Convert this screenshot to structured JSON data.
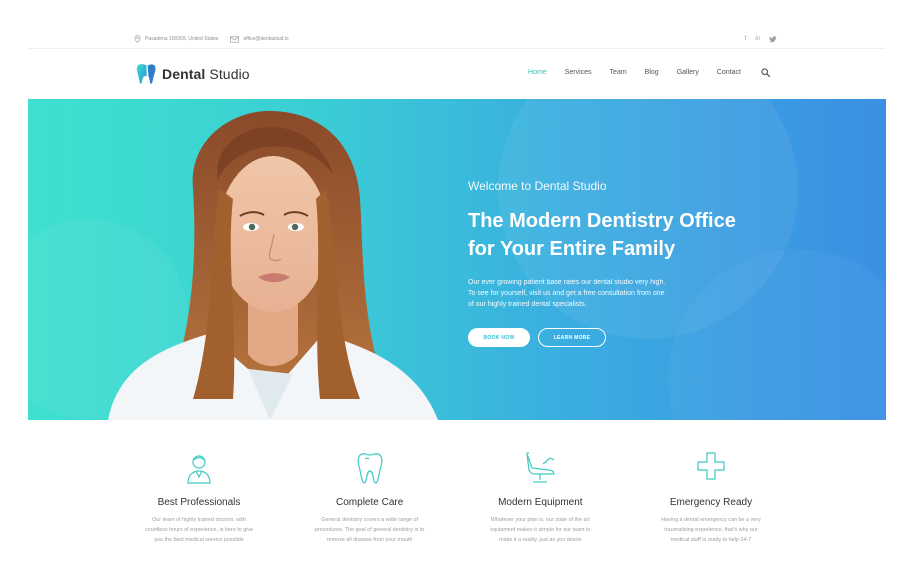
{
  "topbar": {
    "address": "Pasadena 100269, United States",
    "email": "office@dentalstud.io",
    "social": {
      "facebook": "f",
      "linkedin": "in",
      "twitter": "t"
    }
  },
  "logo": {
    "bold": "Dental",
    "light": " Studio"
  },
  "nav": {
    "items": [
      {
        "label": "Home",
        "active": true
      },
      {
        "label": "Services",
        "active": false
      },
      {
        "label": "Team",
        "active": false
      },
      {
        "label": "Blog",
        "active": false
      },
      {
        "label": "Gallery",
        "active": false
      },
      {
        "label": "Contact",
        "active": false
      }
    ],
    "search_icon": "search-icon"
  },
  "hero": {
    "kicker": "Welcome to Dental Studio",
    "title_line1": "The Modern Dentistry Office",
    "title_line2": "for Your Entire Family",
    "desc_line1": "Our ever growing patient base rates our dental studio very high.",
    "desc_line2": "To see for yourself, visit us and get a free consultation from one",
    "desc_line3": "of our highly trained dental specialists.",
    "book_button": "Book Now",
    "learn_button": "Learn More"
  },
  "features": [
    {
      "icon": "doctor-icon",
      "title": "Best Professionals",
      "desc_line1": "Our team of highly trained doctors, with",
      "desc_line2": "countless hours of experience, is here to give",
      "desc_line3": "you the best medical service possible"
    },
    {
      "icon": "tooth-icon",
      "title": "Complete Care",
      "desc_line1": "General dentistry covers a wide range of",
      "desc_line2": "procedures. The goal of general dentistry is to",
      "desc_line3": "remove all disease from your mouth"
    },
    {
      "icon": "dental-chair-icon",
      "title": "Modern Equipment",
      "desc_line1": "Whatever your plan is, our state of the art",
      "desc_line2": "equipment makes it simple for our team to",
      "desc_line3": "make it a reality, just as you desire"
    },
    {
      "icon": "medical-cross-icon",
      "title": "Emergency Ready",
      "desc_line1": "Having a dental emergency can be a very",
      "desc_line2": "traumatizing experience, that's why our",
      "desc_line3": "medical staff is ready to help 24-7"
    }
  ],
  "colors": {
    "accent": "#2fc8b8",
    "hero_start": "#3fe0cf",
    "hero_end": "#3b8fe3",
    "text_dark": "#333333",
    "text_muted": "#9aa0a6"
  }
}
